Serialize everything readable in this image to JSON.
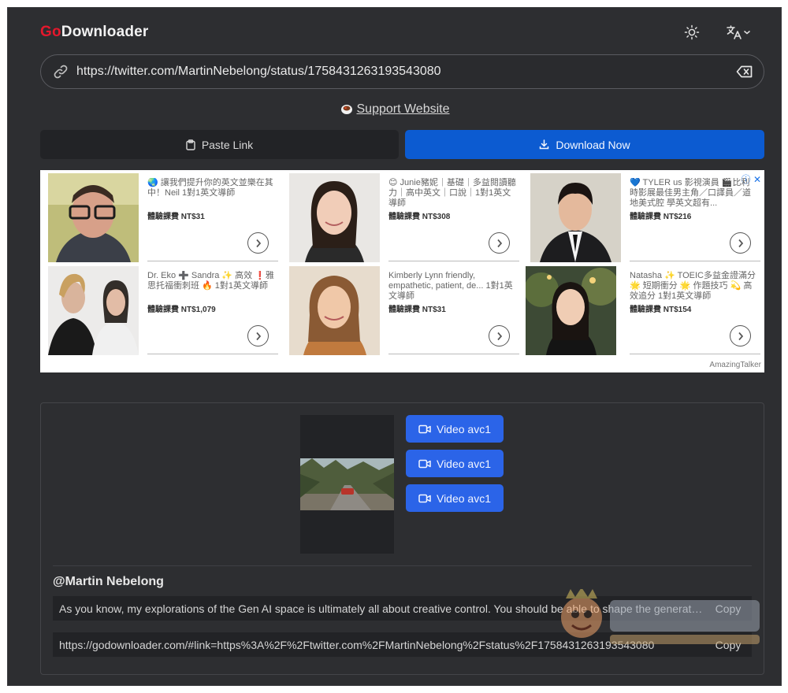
{
  "header": {
    "logo_go": "Go",
    "logo_rest": "Downloader"
  },
  "url_input": {
    "value": "https://twitter.com/MartinNebelong/status/1758431263193543080"
  },
  "support": {
    "label": "Support Website"
  },
  "buttons": {
    "paste_label": "Paste Link",
    "download_label": "Download Now"
  },
  "ad": {
    "brand": "AmazingTalker",
    "cards": [
      {
        "desc": "🌏 讓我們提升你的英文並樂在其中！Neil 1對1英文導師",
        "price": "體驗課費 NT$31"
      },
      {
        "desc": "😊 Junie豬妮｜基礎｜多益閱讀聽力｜高中英文｜口說｜1對1英文導師",
        "price": "體驗課費 NT$308"
      },
      {
        "desc": "💙 TYLER us 影視演員 🎬比利時影展最佳男主角／口譯員／道地美式腔 學英文超有...",
        "price": "體驗課費 NT$216"
      },
      {
        "desc": "Dr. Eko ➕ Sandra ✨ 高效 ❗雅思托福衝刺班 🔥 1對1英文導師",
        "price": "體驗課費 NT$1,079"
      },
      {
        "desc": "Kimberly Lynn friendly, empathetic, patient, de... 1對1英文導師",
        "price": "體驗課費 NT$31"
      },
      {
        "desc": "Natasha ✨ TOEIC多益金證滿分 🌟 短期衝分 🌟 作題技巧 💫 高效追分 1對1英文導師",
        "price": "體驗課費 NT$154"
      }
    ]
  },
  "result": {
    "video_buttons": [
      "Video avc1",
      "Video avc1",
      "Video avc1"
    ],
    "author": "@Martin Nebelong",
    "caption": "As you know, my explorations of the Gen AI space is ultimately all about creative control. You should be able to shape the generative ...",
    "share_link": "https://godownloader.com/#link=https%3A%2F%2Ftwitter.com%2FMartinNebelong%2Fstatus%2F1758431263193543080",
    "copy_label": "Copy"
  },
  "colors": {
    "background": "#2d2e31",
    "accent": "#0c5bd1",
    "video_button": "#2b64e8",
    "logo_red": "#e4182c"
  },
  "icons": [
    "sun-icon",
    "translate-icon",
    "link-icon",
    "clear-icon",
    "coffee-icon",
    "clipboard-icon",
    "download-icon",
    "video-camera-icon",
    "chevron-right-icon"
  ]
}
